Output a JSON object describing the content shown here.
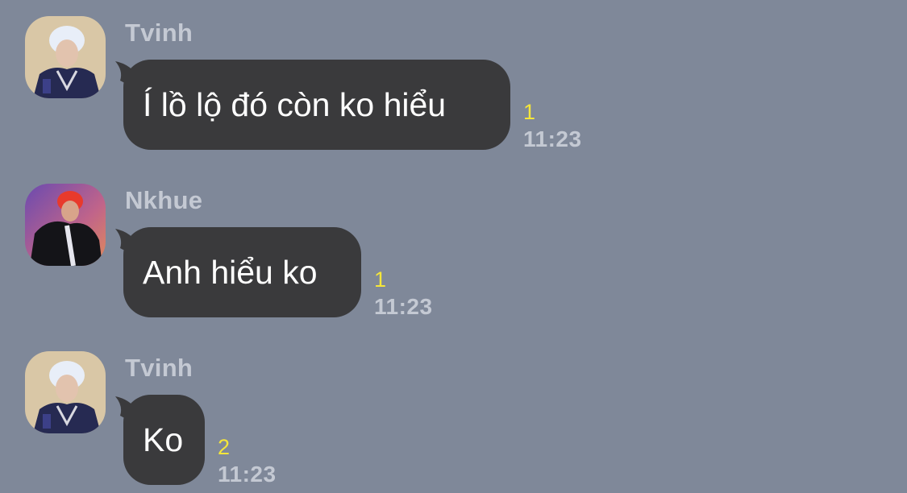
{
  "messages": [
    {
      "sender": "Tvinh",
      "avatar_icon": "avatar-tvinh",
      "text": "Í lồ lộ đó còn ko hiểu",
      "read_count": "1",
      "time": "11:23"
    },
    {
      "sender": "Nkhue",
      "avatar_icon": "avatar-nkhue",
      "text": "Anh hiểu ko",
      "read_count": "1",
      "time": "11:23"
    },
    {
      "sender": "Tvinh",
      "avatar_icon": "avatar-tvinh",
      "text": "Ko",
      "read_count": "2",
      "time": "11:23"
    }
  ],
  "colors": {
    "background": "#7f8899",
    "bubble": "#3a3a3c",
    "read_count": "#f5e63a",
    "meta_text": "#c4c9d3"
  }
}
